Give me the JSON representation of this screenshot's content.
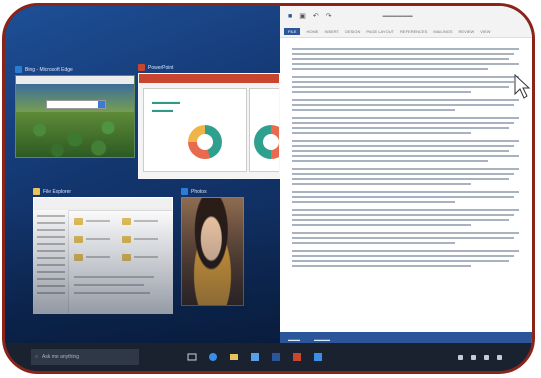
{
  "thumbnails": {
    "edge": {
      "title": "Bing - Microsoft Edge",
      "icon": "edge-icon",
      "accent": "#2c7cd6"
    },
    "powerpoint": {
      "title": "PowerPoint",
      "icon": "powerpoint-icon",
      "accent": "#c8462d"
    },
    "file_explorer": {
      "title": "File Explorer",
      "icon": "folder-icon",
      "accent": "#e8c25a"
    },
    "photos": {
      "title": "Photos",
      "icon": "photos-icon",
      "accent": "#2c7cd6"
    }
  },
  "word": {
    "ribbon_tabs": [
      "FILE",
      "HOME",
      "INSERT",
      "DESIGN",
      "PAGE LAYOUT",
      "REFERENCES",
      "MAILINGS",
      "REVIEW",
      "VIEW"
    ],
    "accent": "#2b579a"
  },
  "taskbar": {
    "search_placeholder": "Ask me anything",
    "pinned": [
      "task-view-icon",
      "edge-icon",
      "file-explorer-icon",
      "store-icon",
      "word-icon",
      "powerpoint-icon",
      "photos-icon"
    ]
  }
}
